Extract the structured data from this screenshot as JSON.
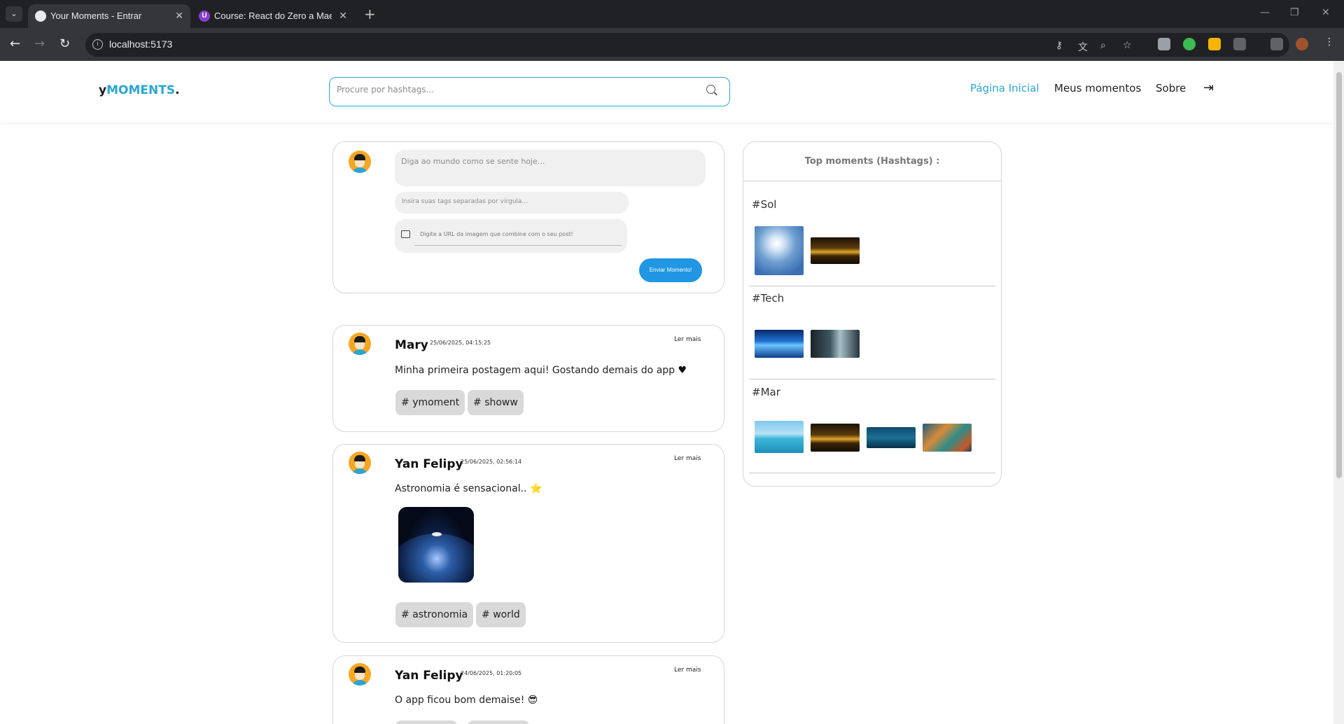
{
  "browser": {
    "tabs": [
      {
        "title": "Your Moments - Entrar",
        "active": true
      },
      {
        "title": "Course: React do Zero a Maestro",
        "active": false
      }
    ],
    "url": "localhost:5173"
  },
  "header": {
    "logo_prefix": "y",
    "logo_main": "MOMENTS",
    "logo_suffix": ".",
    "search_placeholder": "Procure por hashtags...",
    "nav": [
      "Página Inicial",
      "Meus momentos",
      "Sobre"
    ],
    "active_nav": "Página Inicial"
  },
  "composer": {
    "text_placeholder": "Diga ao mundo como se sente hoje...",
    "tags_placeholder": "Insira suas tags separadas por vírgula...",
    "url_placeholder": "Digite a URL da imagem que combine com o seu post!",
    "submit_label": "Enviar Momento!"
  },
  "posts": [
    {
      "author": "Mary",
      "timestamp": "25/06/2025, 04:15:25",
      "read_more": "Ler mais",
      "text": "Minha primeira postagem aqui! Gostando demais do app",
      "emoji": "♥",
      "tags": [
        "ymoment",
        "showw"
      ]
    },
    {
      "author": "Yan Felipy",
      "timestamp": "25/06/2025, 02:56:14",
      "read_more": "Ler mais",
      "text": "Astronomia é sensacional..",
      "emoji": "⭐",
      "image": "earth-from-space",
      "tags": [
        "astronomia",
        "world"
      ]
    },
    {
      "author": "Yan Felipy",
      "timestamp": "24/06/2025, 01:20:05",
      "read_more": "Ler mais",
      "text": "O app ficou bom demaise!",
      "emoji": "😎",
      "tags": []
    }
  ],
  "sidebar": {
    "title": "Top moments (Hashtags) :",
    "sections": [
      {
        "hashtag": "#Sol",
        "images": [
          "cloudy-sky",
          "sunset"
        ]
      },
      {
        "hashtag": "#Tech",
        "images": [
          "blue-tech-screen",
          "server-room"
        ]
      },
      {
        "hashtag": "#Mar",
        "images": [
          "tropical-sea",
          "sunset",
          "underwater",
          "coral-reef"
        ]
      }
    ]
  },
  "colors": {
    "accent": "#2ba5d3",
    "button": "#2196e3",
    "tag_bg": "#d9d9d9"
  }
}
